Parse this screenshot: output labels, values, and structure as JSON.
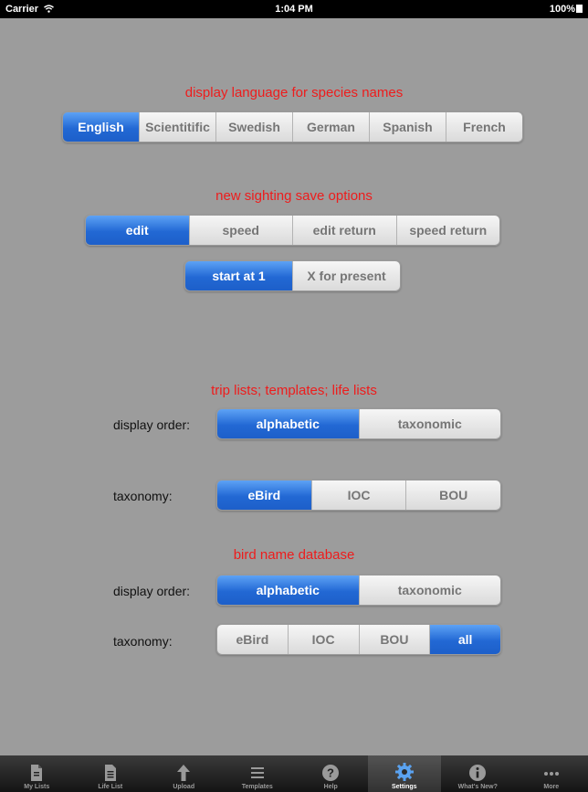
{
  "status": {
    "carrier": "Carrier",
    "time": "1:04 PM",
    "battery": "100%"
  },
  "language": {
    "title": "display language for species names",
    "options": [
      "English",
      "Scientitific",
      "Swedish",
      "German",
      "Spanish",
      "French"
    ],
    "selected": "English"
  },
  "save": {
    "title": "new sighting save options",
    "options": [
      "edit",
      "speed",
      "edit return",
      "speed return"
    ],
    "selected": "edit",
    "count_options": [
      "start at 1",
      "X for present"
    ],
    "count_selected": "start at 1"
  },
  "trip": {
    "title": "trip lists; templates; life lists",
    "order_label": "display order:",
    "order_options": [
      "alphabetic",
      "taxonomic"
    ],
    "order_selected": "alphabetic",
    "taxonomy_label": "taxonomy:",
    "taxonomy_options": [
      "eBird",
      "IOC",
      "BOU"
    ],
    "taxonomy_selected": "eBird"
  },
  "db": {
    "title": "bird name database",
    "order_label": "display order:",
    "order_options": [
      "alphabetic",
      "taxonomic"
    ],
    "order_selected": "alphabetic",
    "taxonomy_label": "taxonomy:",
    "taxonomy_options": [
      "eBird",
      "IOC",
      "BOU",
      "all"
    ],
    "taxonomy_selected": "all"
  },
  "tabs": [
    {
      "label": "My Lists",
      "icon": "my-lists-icon"
    },
    {
      "label": "Life List",
      "icon": "life-list-icon"
    },
    {
      "label": "Upload",
      "icon": "upload-icon"
    },
    {
      "label": "Templates",
      "icon": "templates-icon"
    },
    {
      "label": "Help",
      "icon": "help-icon"
    },
    {
      "label": "Settings",
      "icon": "settings-icon"
    },
    {
      "label": "What's New?",
      "icon": "whats-new-icon"
    },
    {
      "label": "More",
      "icon": "more-icon"
    }
  ],
  "active_tab": "Settings",
  "colors": {
    "accent": "#2268d4",
    "title_red": "#ee1c1c",
    "background": "#9c9c9c"
  }
}
